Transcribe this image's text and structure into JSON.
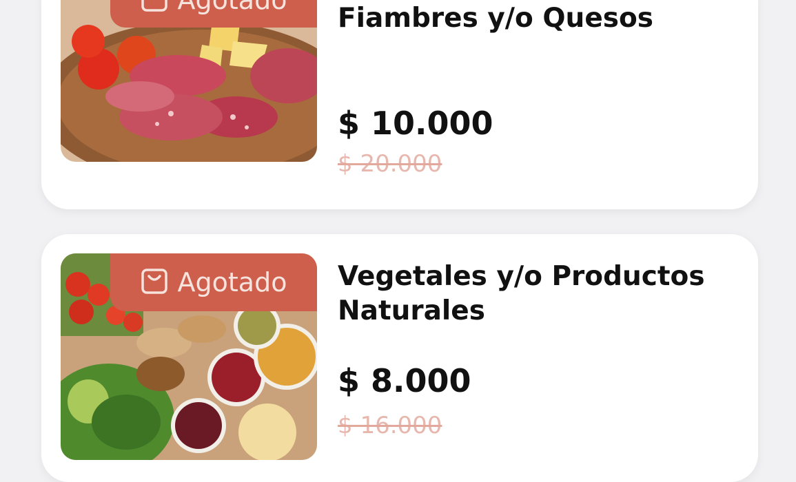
{
  "products": [
    {
      "badge": "Agotado",
      "title": "Fiambres y/o Quesos",
      "price": "$ 10.000",
      "old_price": "$ 20.000",
      "image": "cold-cuts-and-cheese-platter"
    },
    {
      "badge": "Agotado",
      "title": "Vegetales y/o Productos Naturales",
      "price": "$ 8.000",
      "old_price": "$ 16.000",
      "image": "vegetables-and-legumes-spread"
    }
  ],
  "colors": {
    "badge_bg": "#cd5f4c",
    "badge_text": "#f7e3dd",
    "old_price": "#e7b7ad",
    "page_bg": "#f1f1f3"
  },
  "icons": {
    "badge_icon": "shopping-bag-icon"
  }
}
